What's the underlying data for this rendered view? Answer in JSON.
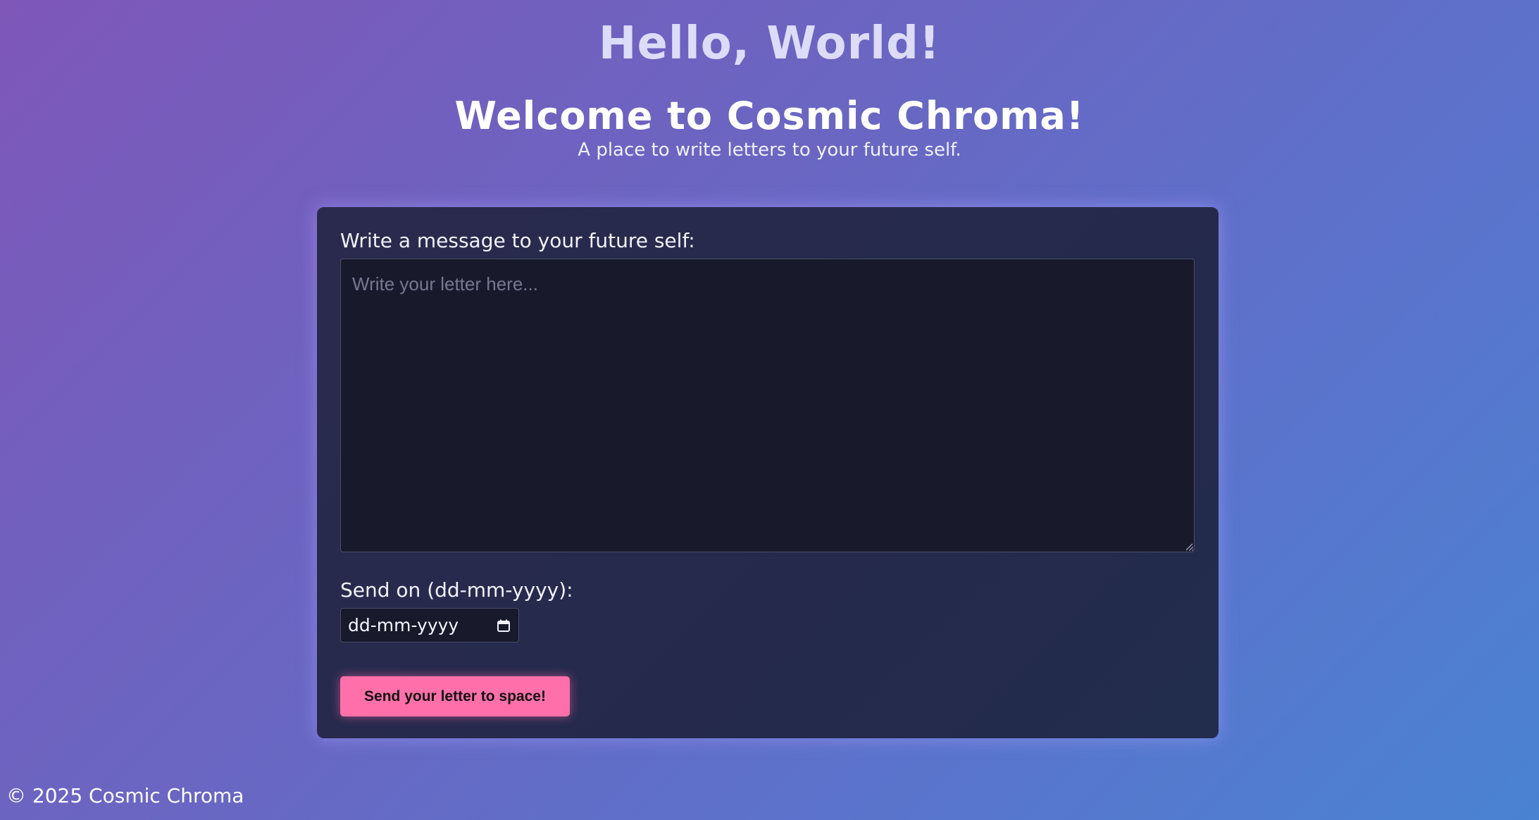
{
  "header": {
    "hello": "Hello, World!",
    "welcome": "Welcome to Cosmic Chroma!",
    "tagline": "A place to write letters to your future self."
  },
  "form": {
    "message_label": "Write a message to your future self:",
    "message_placeholder": "Write your letter here...",
    "message_value": "",
    "date_label": "Send on (dd-mm-yyyy):",
    "date_placeholder": "dd-mm-yyyy",
    "date_icon": "calendar-icon",
    "submit_label": "Send your letter to space!"
  },
  "footer": {
    "text": "© 2025 Cosmic Chroma"
  },
  "colors": {
    "button": "#ff70aa",
    "card": "#262a4c",
    "input_bg": "#181a2c"
  }
}
